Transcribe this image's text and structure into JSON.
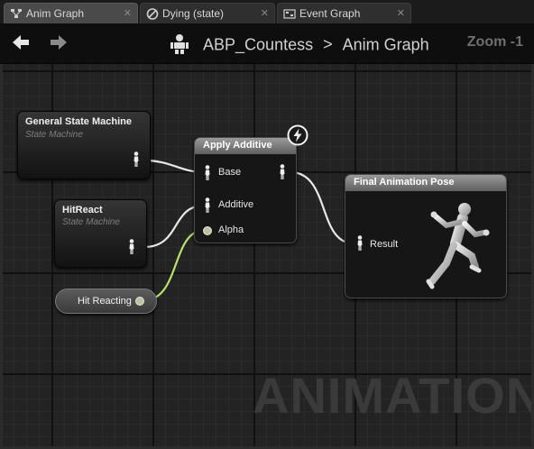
{
  "tabs": [
    {
      "label": "Anim Graph",
      "close": "✕",
      "icon": "graph-icon"
    },
    {
      "label": "Dying (state)",
      "close": "✕",
      "icon": "state-icon"
    },
    {
      "label": "Event Graph",
      "close": "✕",
      "icon": "event-graph-icon"
    }
  ],
  "header": {
    "breadcrumb": {
      "asset": "ABP_Countess",
      "separator": ">",
      "graph": "Anim Graph"
    },
    "zoom": "Zoom -1"
  },
  "nodes": {
    "general_state_machine": {
      "title": "General State Machine",
      "subtitle": "State Machine"
    },
    "hit_react": {
      "title": "HitReact",
      "subtitle": "State Machine"
    },
    "apply_additive": {
      "title": "Apply Additive",
      "pins": {
        "base": "Base",
        "additive": "Additive",
        "alpha": "Alpha"
      }
    },
    "final_pose": {
      "title": "Final Animation Pose",
      "pins": {
        "result": "Result"
      }
    },
    "hit_reacting": {
      "label": "Hit Reacting"
    }
  },
  "watermark": "ANIMATION",
  "colors": {
    "pose_wire": "#e8e8e8",
    "float_wire": "#b5e36a",
    "node_header": "#7a7a7a",
    "canvas_bg": "#232323"
  }
}
